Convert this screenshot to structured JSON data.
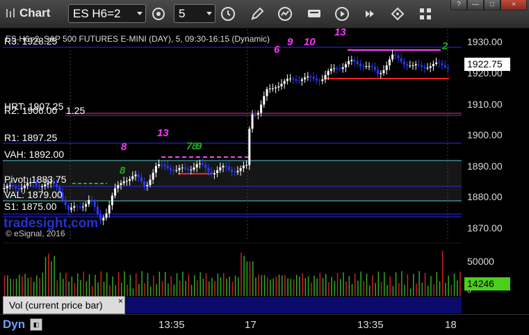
{
  "toolbar": {
    "title": "Chart",
    "symbol": "ES H6=2",
    "interval": "5"
  },
  "chart": {
    "header": "ES H6=2, S&P 500 FUTURES E-MINI (DAY), 5, 09:30-16:15 (Dynamic)",
    "watermark": "tradesight.com",
    "copyright": "© eSignal, 2016",
    "current_price": "1922.75",
    "price_ticks": [
      "1930.00",
      "1920.00",
      "1910.00",
      "1900.00",
      "1890.00",
      "1880.00",
      "1870.00"
    ],
    "levels": [
      {
        "label": "R3: 1928.25",
        "color": "#3a3aff"
      },
      {
        "label": "HRT: 1907.25",
        "color": "#ff5577"
      },
      {
        "label": "R2: 1906.00",
        "color": "#3a3aff"
      },
      {
        "label": "R1: 1897.25",
        "color": "#3a3aff"
      },
      {
        "label": "VAH: 1892.00",
        "color": "#66dddd"
      },
      {
        "label": "Pivot: 1883.75",
        "color": "#3a3aff"
      },
      {
        "label": "VAL: 1879.00",
        "color": "#66dddd"
      },
      {
        "label": "S1: 1875.00",
        "color": "#3a3aff"
      }
    ],
    "extra_level_text": "1.25",
    "td_labels": [
      "8",
      "9",
      "10",
      "13",
      "6",
      "7",
      "8",
      "9",
      "13",
      "8",
      "2"
    ]
  },
  "volume": {
    "label": "Vol (current price bar)",
    "close": "×",
    "ticks": [
      "50000",
      "0"
    ],
    "current_value": "14246"
  },
  "x_axis": {
    "ticks": [
      "13:35",
      "17",
      "13:35",
      "18"
    ]
  },
  "bottom": {
    "mode": "Dyn"
  }
}
